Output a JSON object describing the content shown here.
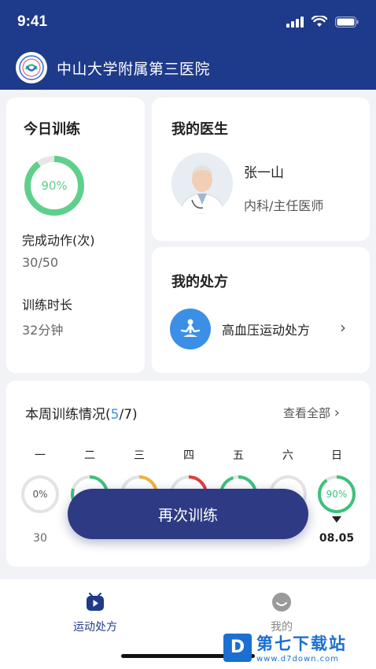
{
  "status_bar": {
    "time": "9:41"
  },
  "header": {
    "hospital_name": "中山大学附属第三医院"
  },
  "today_training": {
    "title": "今日训练",
    "progress_label": "90%",
    "progress_fraction": 0.9,
    "actions_label": "完成动作(次)",
    "actions_value": "30/50",
    "duration_label": "训练时长",
    "duration_value": "32分钟"
  },
  "my_doctor": {
    "title": "我的医生",
    "name": "张一山",
    "role": "内科/主任医师"
  },
  "my_prescription": {
    "title": "我的处方",
    "name": "高血压运动处方"
  },
  "weekly": {
    "title_prefix": "本周训练情况(",
    "done": "5",
    "title_suffix": "/7)",
    "view_all": "查看全部",
    "days": [
      {
        "label": "一",
        "ring_label": "0%",
        "fraction": 0.0,
        "color": "#cccccc",
        "date": "30"
      },
      {
        "label": "二",
        "ring_label": "",
        "fraction": 0.8,
        "color": "#3cc17b",
        "date": ""
      },
      {
        "label": "三",
        "ring_label": "",
        "fraction": 0.45,
        "color": "#f0b23a",
        "date": ""
      },
      {
        "label": "四",
        "ring_label": "",
        "fraction": 0.3,
        "color": "#e23b3b",
        "date": ""
      },
      {
        "label": "五",
        "ring_label": "",
        "fraction": 0.95,
        "color": "#3cc17b",
        "date": ""
      },
      {
        "label": "六",
        "ring_label": "",
        "fraction": 0.0,
        "color": "#cccccc",
        "date": ""
      },
      {
        "label": "日",
        "ring_label": "90%",
        "fraction": 0.9,
        "color": "#3cc17b",
        "date": "08.05"
      }
    ]
  },
  "retrain_button": "再次训练",
  "tabs": [
    {
      "label": "运动处方",
      "active": true
    },
    {
      "label": "我的",
      "active": false
    }
  ],
  "watermark": {
    "main": "第七下载站",
    "sub": "www.d7down.com"
  },
  "colors": {
    "primary": "#1e3a8a",
    "accent_green": "#3cc17b",
    "accent_blue": "#3b8fe6"
  }
}
